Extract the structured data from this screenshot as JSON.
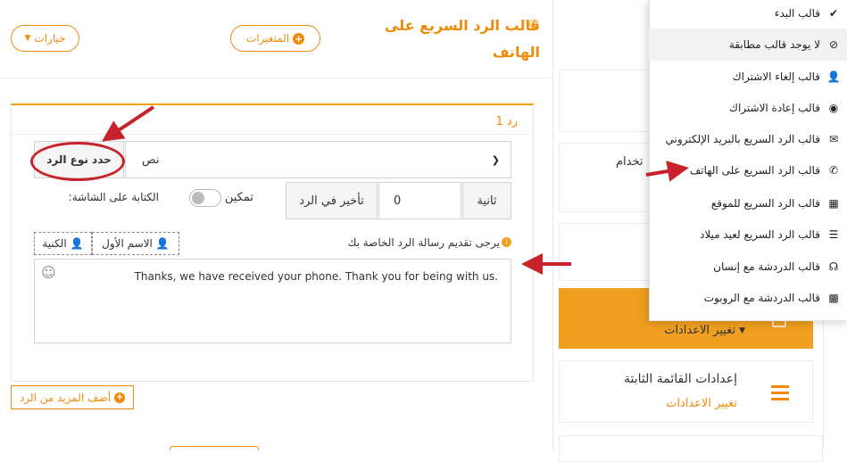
{
  "header": {
    "title": "قالب الرد السريع على الهاتف",
    "variables_button": "المتغيرات",
    "options_button": "خيارات"
  },
  "reply": {
    "label": "رد 1",
    "type_label": "حدد نوع الرد",
    "type_value": "نص",
    "delay_unit": "ثانية",
    "delay_value": "0",
    "delay_label": "تأخير في الرد",
    "enable_label": "تمكين",
    "typing_label": ":الكتابة على الشاشة",
    "hint": "يرجى تقديم رسالة الرد الخاصة بك",
    "first_name_tag": "الاسم الأول",
    "last_name_tag": "الكنية",
    "message": "Thanks, we have received your phone. Thank you for being with us."
  },
  "add_more_button": "أضف المزيد من الرد",
  "sidebar": {
    "change_settings": "تغيير الاعدادات",
    "fixed_menu_title": "إعدادات القائمة الثابتة",
    "fixed_menu_link": "تغيير الاعدادات",
    "partial_text": "تخدام"
  },
  "dropdown": {
    "items": [
      {
        "label": "قالب البدء",
        "icon": "check-circle-icon"
      },
      {
        "label": "لا يوجد قالب مطابقة",
        "icon": "eye-slash-icon"
      },
      {
        "label": "قالب إلغاء الاشتراك",
        "icon": "user-slash-icon"
      },
      {
        "label": "قالب إعادة الاشتراك",
        "icon": "user-circle-icon"
      },
      {
        "label": "قالب الرد السريع بالبريد الإلكتروني",
        "icon": "envelope-icon"
      },
      {
        "label": "قالب الرد السريع على الهاتف",
        "icon": "phone-icon"
      },
      {
        "label": "قالب الرد السريع للموقع",
        "icon": "map-icon"
      },
      {
        "label": "قالب الرد السريع لعيد ميلاد",
        "icon": "birthday-cake-icon"
      },
      {
        "label": "قالب الدردشة مع إنسان",
        "icon": "headset-icon"
      },
      {
        "label": "قالب الدردشة مع الروبوت",
        "icon": "robot-icon"
      }
    ]
  },
  "colors": {
    "accent": "#f08c0a",
    "panel_orange": "#f0a020",
    "arrow_red": "#c8232c"
  }
}
